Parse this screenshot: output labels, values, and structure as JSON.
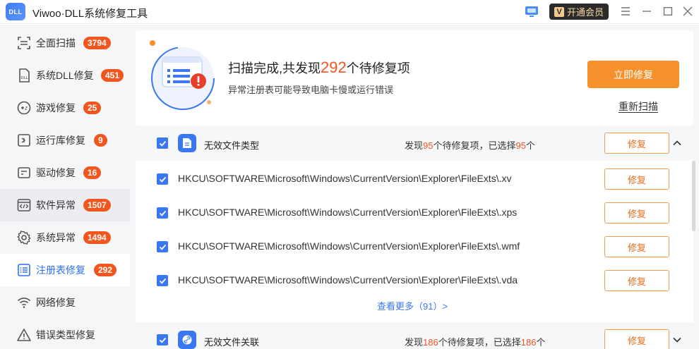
{
  "app": {
    "logo_text": "DLL",
    "title": "Viwoo·DLL系统修复工具"
  },
  "titlebar": {
    "vip_icon": "V",
    "vip_label": "开通会员",
    "menu_icon": "menu-icon",
    "min_icon": "minimize-icon",
    "max_icon": "maximize-icon",
    "close_icon": "close-icon"
  },
  "sidebar": {
    "items": [
      {
        "label": "全面扫描",
        "badge": "3794",
        "icon": "scan-icon"
      },
      {
        "label": "系统DLL修复",
        "badge": "451",
        "icon": "dll-file-icon"
      },
      {
        "label": "游戏修复",
        "badge": "25",
        "icon": "gamepad-icon"
      },
      {
        "label": "运行库修复",
        "badge": "9",
        "icon": "runtime-icon"
      },
      {
        "label": "驱动修复",
        "badge": "16",
        "icon": "driver-icon"
      },
      {
        "label": "软件异常",
        "badge": "1507",
        "icon": "code-window-icon"
      },
      {
        "label": "系统异常",
        "badge": "1494",
        "icon": "gear-icon"
      },
      {
        "label": "注册表修复",
        "badge": "292",
        "icon": "registry-list-icon"
      },
      {
        "label": "网络修复",
        "badge": "",
        "icon": "wifi-icon"
      },
      {
        "label": "错误类型修复",
        "badge": "",
        "icon": "warning-icon"
      }
    ]
  },
  "banner": {
    "title_prefix": "扫描完成,共发现",
    "title_count": "292",
    "title_suffix": "个待修复项",
    "subtitle": "异常注册表可能导致电脑卡慢或运行错误",
    "repair_all_label": "立即修复",
    "rescan_label": "重新扫描"
  },
  "groups": [
    {
      "name": "无效文件类型",
      "stat_prefix": "发现",
      "found": "95",
      "stat_mid": "个待修复项，已选择",
      "selected": "95",
      "stat_suffix": "个",
      "fix_label": "修复",
      "rows": [
        {
          "path": "HKCU\\SOFTWARE\\Microsoft\\Windows\\CurrentVersion\\Explorer\\FileExts\\.xv",
          "fix_label": "修复"
        },
        {
          "path": "HKCU\\SOFTWARE\\Microsoft\\Windows\\CurrentVersion\\Explorer\\FileExts\\.xps",
          "fix_label": "修复"
        },
        {
          "path": "HKCU\\SOFTWARE\\Microsoft\\Windows\\CurrentVersion\\Explorer\\FileExts\\.wmf",
          "fix_label": "修复"
        },
        {
          "path": "HKCU\\SOFTWARE\\Microsoft\\Windows\\CurrentVersion\\Explorer\\FileExts\\.vda",
          "fix_label": "修复"
        }
      ],
      "more_label": "查看更多（91）>"
    },
    {
      "name": "无效文件关联",
      "stat_prefix": "发现",
      "found": "186",
      "stat_mid": "个待修复项，已选择",
      "selected": "186",
      "stat_suffix": "个",
      "fix_label": "修复"
    }
  ],
  "colors": {
    "accent": "#3a78f2",
    "badge": "#f1561f",
    "repair": "#f7912b"
  }
}
